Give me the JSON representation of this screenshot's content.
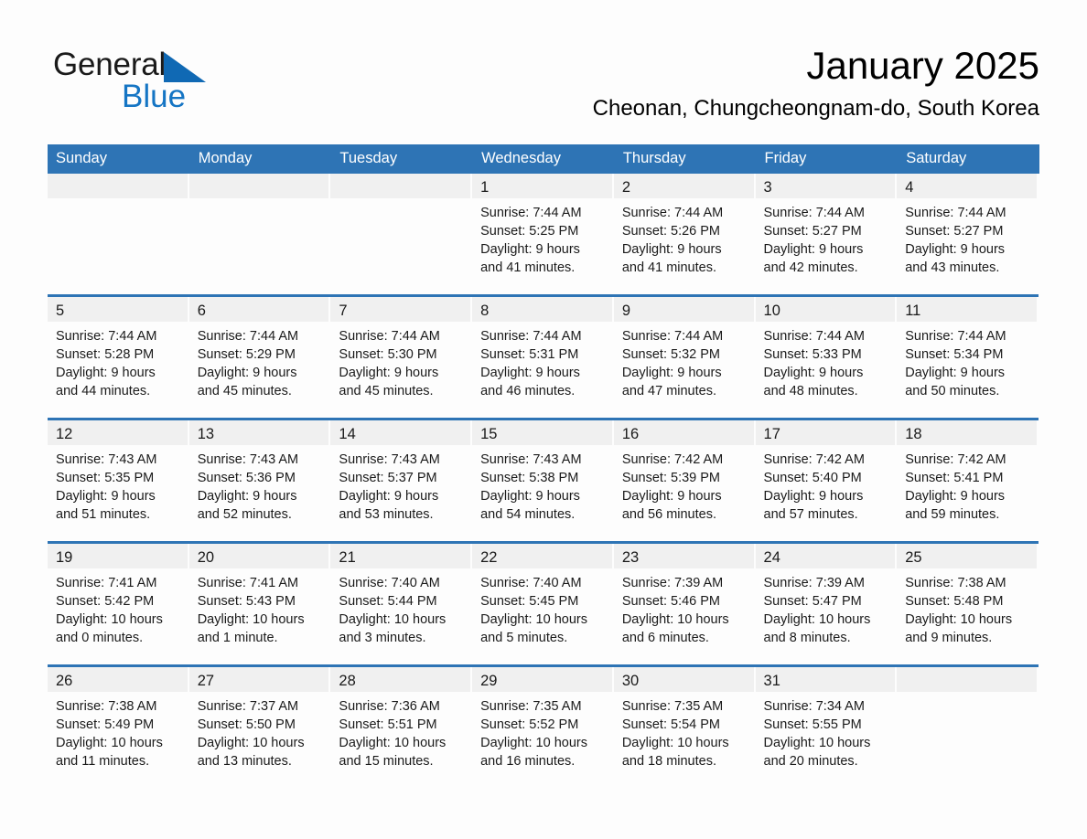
{
  "brand": {
    "name_part1": "General",
    "name_part2": "Blue",
    "accent_color": "#1575c4",
    "triangle_color": "#1069b4"
  },
  "header": {
    "title": "January 2025",
    "subtitle": "Cheonan, Chungcheongnam-do, South Korea"
  },
  "calendar": {
    "header_bg": "#2e74b5",
    "daynum_bg": "#f0f0f0",
    "weekday_headers": [
      "Sunday",
      "Monday",
      "Tuesday",
      "Wednesday",
      "Thursday",
      "Friday",
      "Saturday"
    ],
    "weeks": [
      [
        {
          "day": "",
          "lines": []
        },
        {
          "day": "",
          "lines": []
        },
        {
          "day": "",
          "lines": []
        },
        {
          "day": "1",
          "lines": [
            "Sunrise: 7:44 AM",
            "Sunset: 5:25 PM",
            "Daylight: 9 hours",
            "and 41 minutes."
          ]
        },
        {
          "day": "2",
          "lines": [
            "Sunrise: 7:44 AM",
            "Sunset: 5:26 PM",
            "Daylight: 9 hours",
            "and 41 minutes."
          ]
        },
        {
          "day": "3",
          "lines": [
            "Sunrise: 7:44 AM",
            "Sunset: 5:27 PM",
            "Daylight: 9 hours",
            "and 42 minutes."
          ]
        },
        {
          "day": "4",
          "lines": [
            "Sunrise: 7:44 AM",
            "Sunset: 5:27 PM",
            "Daylight: 9 hours",
            "and 43 minutes."
          ]
        }
      ],
      [
        {
          "day": "5",
          "lines": [
            "Sunrise: 7:44 AM",
            "Sunset: 5:28 PM",
            "Daylight: 9 hours",
            "and 44 minutes."
          ]
        },
        {
          "day": "6",
          "lines": [
            "Sunrise: 7:44 AM",
            "Sunset: 5:29 PM",
            "Daylight: 9 hours",
            "and 45 minutes."
          ]
        },
        {
          "day": "7",
          "lines": [
            "Sunrise: 7:44 AM",
            "Sunset: 5:30 PM",
            "Daylight: 9 hours",
            "and 45 minutes."
          ]
        },
        {
          "day": "8",
          "lines": [
            "Sunrise: 7:44 AM",
            "Sunset: 5:31 PM",
            "Daylight: 9 hours",
            "and 46 minutes."
          ]
        },
        {
          "day": "9",
          "lines": [
            "Sunrise: 7:44 AM",
            "Sunset: 5:32 PM",
            "Daylight: 9 hours",
            "and 47 minutes."
          ]
        },
        {
          "day": "10",
          "lines": [
            "Sunrise: 7:44 AM",
            "Sunset: 5:33 PM",
            "Daylight: 9 hours",
            "and 48 minutes."
          ]
        },
        {
          "day": "11",
          "lines": [
            "Sunrise: 7:44 AM",
            "Sunset: 5:34 PM",
            "Daylight: 9 hours",
            "and 50 minutes."
          ]
        }
      ],
      [
        {
          "day": "12",
          "lines": [
            "Sunrise: 7:43 AM",
            "Sunset: 5:35 PM",
            "Daylight: 9 hours",
            "and 51 minutes."
          ]
        },
        {
          "day": "13",
          "lines": [
            "Sunrise: 7:43 AM",
            "Sunset: 5:36 PM",
            "Daylight: 9 hours",
            "and 52 minutes."
          ]
        },
        {
          "day": "14",
          "lines": [
            "Sunrise: 7:43 AM",
            "Sunset: 5:37 PM",
            "Daylight: 9 hours",
            "and 53 minutes."
          ]
        },
        {
          "day": "15",
          "lines": [
            "Sunrise: 7:43 AM",
            "Sunset: 5:38 PM",
            "Daylight: 9 hours",
            "and 54 minutes."
          ]
        },
        {
          "day": "16",
          "lines": [
            "Sunrise: 7:42 AM",
            "Sunset: 5:39 PM",
            "Daylight: 9 hours",
            "and 56 minutes."
          ]
        },
        {
          "day": "17",
          "lines": [
            "Sunrise: 7:42 AM",
            "Sunset: 5:40 PM",
            "Daylight: 9 hours",
            "and 57 minutes."
          ]
        },
        {
          "day": "18",
          "lines": [
            "Sunrise: 7:42 AM",
            "Sunset: 5:41 PM",
            "Daylight: 9 hours",
            "and 59 minutes."
          ]
        }
      ],
      [
        {
          "day": "19",
          "lines": [
            "Sunrise: 7:41 AM",
            "Sunset: 5:42 PM",
            "Daylight: 10 hours",
            "and 0 minutes."
          ]
        },
        {
          "day": "20",
          "lines": [
            "Sunrise: 7:41 AM",
            "Sunset: 5:43 PM",
            "Daylight: 10 hours",
            "and 1 minute."
          ]
        },
        {
          "day": "21",
          "lines": [
            "Sunrise: 7:40 AM",
            "Sunset: 5:44 PM",
            "Daylight: 10 hours",
            "and 3 minutes."
          ]
        },
        {
          "day": "22",
          "lines": [
            "Sunrise: 7:40 AM",
            "Sunset: 5:45 PM",
            "Daylight: 10 hours",
            "and 5 minutes."
          ]
        },
        {
          "day": "23",
          "lines": [
            "Sunrise: 7:39 AM",
            "Sunset: 5:46 PM",
            "Daylight: 10 hours",
            "and 6 minutes."
          ]
        },
        {
          "day": "24",
          "lines": [
            "Sunrise: 7:39 AM",
            "Sunset: 5:47 PM",
            "Daylight: 10 hours",
            "and 8 minutes."
          ]
        },
        {
          "day": "25",
          "lines": [
            "Sunrise: 7:38 AM",
            "Sunset: 5:48 PM",
            "Daylight: 10 hours",
            "and 9 minutes."
          ]
        }
      ],
      [
        {
          "day": "26",
          "lines": [
            "Sunrise: 7:38 AM",
            "Sunset: 5:49 PM",
            "Daylight: 10 hours",
            "and 11 minutes."
          ]
        },
        {
          "day": "27",
          "lines": [
            "Sunrise: 7:37 AM",
            "Sunset: 5:50 PM",
            "Daylight: 10 hours",
            "and 13 minutes."
          ]
        },
        {
          "day": "28",
          "lines": [
            "Sunrise: 7:36 AM",
            "Sunset: 5:51 PM",
            "Daylight: 10 hours",
            "and 15 minutes."
          ]
        },
        {
          "day": "29",
          "lines": [
            "Sunrise: 7:35 AM",
            "Sunset: 5:52 PM",
            "Daylight: 10 hours",
            "and 16 minutes."
          ]
        },
        {
          "day": "30",
          "lines": [
            "Sunrise: 7:35 AM",
            "Sunset: 5:54 PM",
            "Daylight: 10 hours",
            "and 18 minutes."
          ]
        },
        {
          "day": "31",
          "lines": [
            "Sunrise: 7:34 AM",
            "Sunset: 5:55 PM",
            "Daylight: 10 hours",
            "and 20 minutes."
          ]
        },
        {
          "day": "",
          "lines": []
        }
      ]
    ]
  }
}
